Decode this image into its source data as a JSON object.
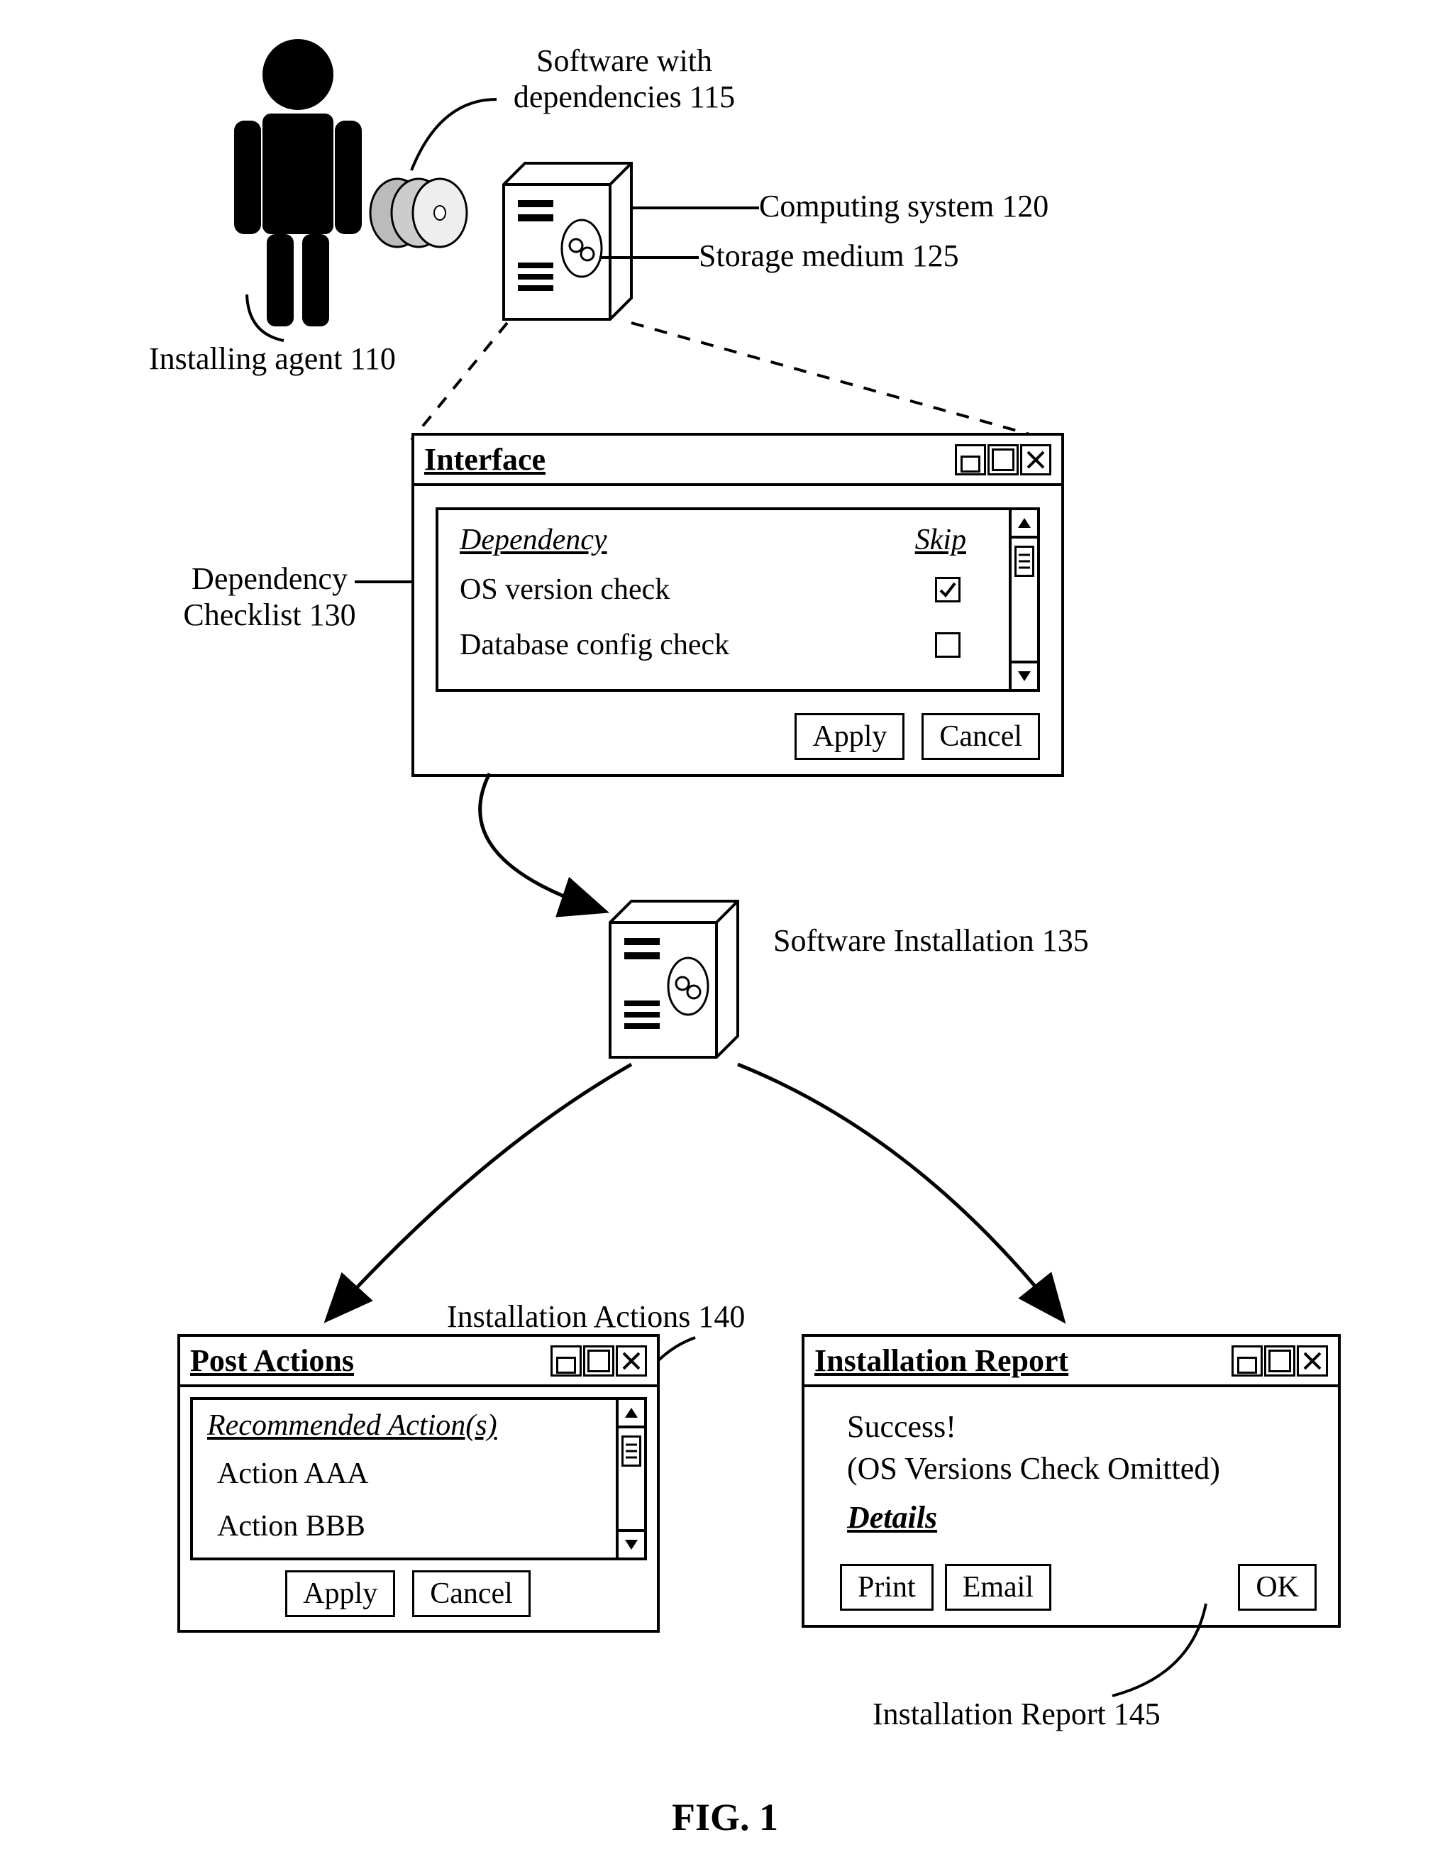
{
  "figure_caption": "FIG. 1",
  "labels": {
    "installing_agent": "Installing agent 110",
    "software_deps": "Software with\ndependencies 115",
    "computing_system": "Computing system 120",
    "storage_medium": "Storage medium 125",
    "dependency_checklist": "Dependency\nChecklist 130",
    "software_installation": "Software Installation 135",
    "installation_actions": "Installation Actions 140",
    "installation_report_label": "Installation Report 145"
  },
  "interface_window": {
    "title": "Interface",
    "col_dependency": "Dependency",
    "col_skip": "Skip",
    "rows": [
      {
        "name": "OS version check",
        "skip_checked": true
      },
      {
        "name": "Database config check",
        "skip_checked": false
      }
    ],
    "apply": "Apply",
    "cancel": "Cancel"
  },
  "post_actions_window": {
    "title": "Post Actions",
    "header": "Recommended Action(s)",
    "actions": [
      "Action AAA",
      "Action BBB"
    ],
    "apply": "Apply",
    "cancel": "Cancel"
  },
  "report_window": {
    "title": "Installation Report",
    "status": "Success!",
    "note": "(OS Versions Check Omitted)",
    "details": "Details",
    "print": "Print",
    "email": "Email",
    "ok": "OK"
  }
}
